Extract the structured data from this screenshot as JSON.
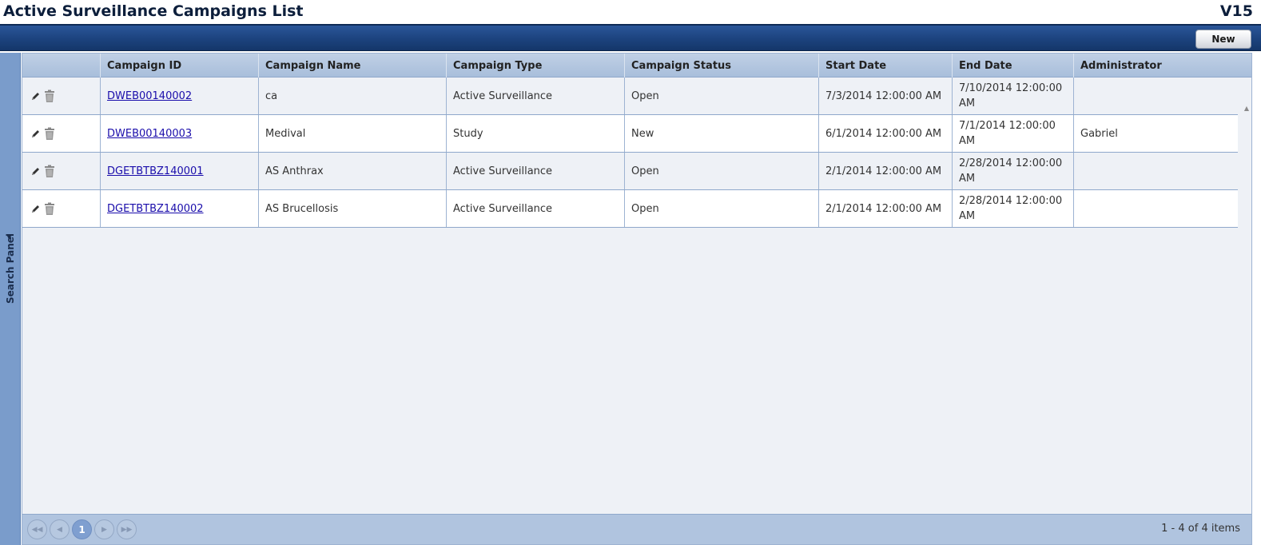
{
  "header": {
    "title": "Active Surveillance Campaigns List",
    "version": "V15"
  },
  "toolbar": {
    "new_label": "New"
  },
  "search_panel": {
    "label": "Search Panel"
  },
  "grid": {
    "columns": [
      "Campaign ID",
      "Campaign Name",
      "Campaign Type",
      "Campaign Status",
      "Start Date",
      "End Date",
      "Administrator"
    ],
    "rows": [
      {
        "id": "DWEB00140002",
        "name": "ca",
        "type": "Active Surveillance",
        "status": "Open",
        "start": "7/3/2014 12:00:00 AM",
        "end": "7/10/2014 12:00:00 AM",
        "admin": ""
      },
      {
        "id": "DWEB00140003",
        "name": "Medival",
        "type": "Study",
        "status": "New",
        "start": "6/1/2014 12:00:00 AM",
        "end": "7/1/2014 12:00:00 AM",
        "admin": "Gabriel"
      },
      {
        "id": "DGETBTBZ140001",
        "name": "AS Anthrax",
        "type": "Active Surveillance",
        "status": "Open",
        "start": "2/1/2014 12:00:00 AM",
        "end": "2/28/2014 12:00:00 AM",
        "admin": ""
      },
      {
        "id": "DGETBTBZ140002",
        "name": "AS Brucellosis",
        "type": "Active Surveillance",
        "status": "Open",
        "start": "2/1/2014 12:00:00 AM",
        "end": "2/28/2014 12:00:00 AM",
        "admin": ""
      }
    ]
  },
  "pager": {
    "current_page": "1",
    "info": "1 - 4 of 4 items"
  },
  "icons": {
    "edit": "pencil-icon",
    "delete": "trash-icon"
  },
  "colors": {
    "toolbar": "#1d4480",
    "header_bg": "#a8bedb",
    "link": "#1a0dab",
    "panel": "#7a9ccb"
  }
}
